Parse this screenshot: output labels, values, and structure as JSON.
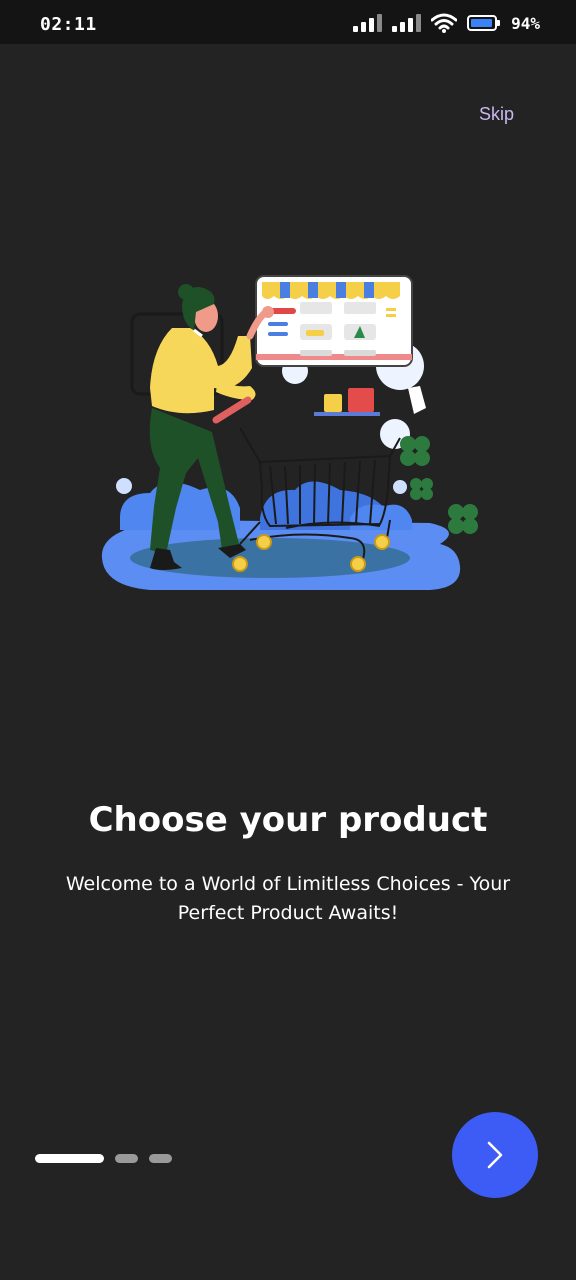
{
  "status_bar": {
    "time": "02:11",
    "battery_percent": "94%",
    "battery_level": 0.94,
    "icons": [
      "signal-icon",
      "signal-icon",
      "wifi-icon",
      "battery-icon"
    ]
  },
  "onboarding": {
    "skip_label": "Skip",
    "title": "Choose your product",
    "subtitle": "Welcome to a World of Limitless Choices - Your Perfect Product Awaits!",
    "page_indicator": {
      "total": 3,
      "current": 1
    },
    "next_icon": "chevron-right-icon",
    "illustration": "shopping-cart-illustration"
  },
  "colors": {
    "background": "#232323",
    "accent": "#3d5cf5",
    "skip": "#c8b8f0",
    "status_bar": "#141414"
  }
}
